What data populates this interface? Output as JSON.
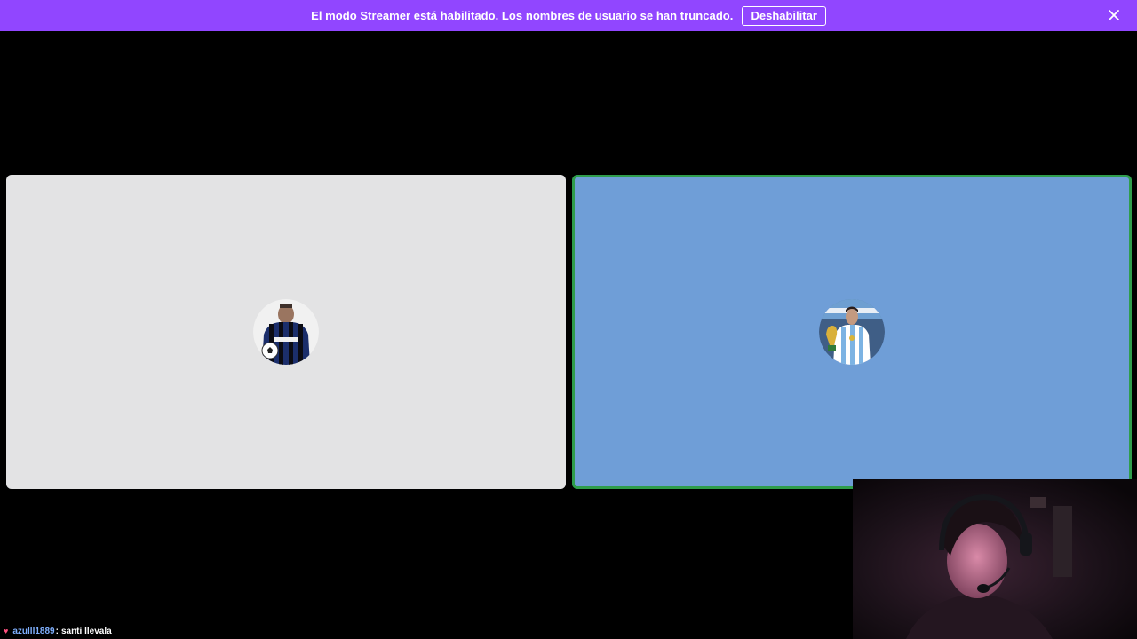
{
  "banner": {
    "message": "El modo Streamer está habilitado. Los nombres de usuario se han truncado.",
    "button_label": "Deshabilitar",
    "close_icon": "close-icon",
    "color": "#9146ff"
  },
  "call": {
    "participants": [
      {
        "avatar_icon": "user-avatar-football-jersey",
        "tile_color": "#e3e3e4",
        "speaking": false
      },
      {
        "avatar_icon": "user-avatar-trophy",
        "tile_color": "#6f9ed7",
        "speaking": true,
        "speaking_color": "#2f9d4c"
      }
    ]
  },
  "webcam": {
    "icon": "streamer-webcam-feed"
  },
  "chat": {
    "heart_icon": "♥",
    "username": "azulll1889",
    "separator": ":",
    "message": "santi llevala",
    "username_color": "#7fb0ff"
  }
}
